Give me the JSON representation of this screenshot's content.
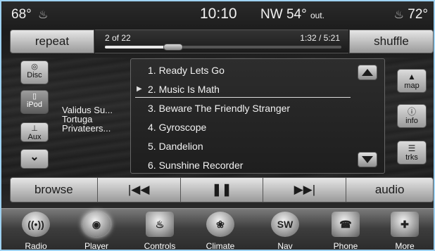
{
  "status": {
    "temp_left": "68°",
    "temp_right": "72°",
    "clock": "10:10",
    "heading": "NW",
    "outside_temp": "54°",
    "outside_label": "out."
  },
  "top": {
    "repeat_label": "repeat",
    "shuffle_label": "shuffle",
    "track_count": "2 of 22",
    "track_time": "1:32 / 5:21",
    "progress_fraction": 0.29
  },
  "sources": [
    {
      "label": "Disc",
      "icon": "disc-icon"
    },
    {
      "label": "iPod",
      "icon": "ipod-icon"
    },
    {
      "label": "Aux",
      "icon": "aux-icon"
    }
  ],
  "now_playing": {
    "line1": "Validus Su...",
    "line2": "Tortuga",
    "line3": "Privateers..."
  },
  "tracks": [
    "1. Ready Lets Go",
    "2. Music Is Math",
    "3. Beware The Friendly Stranger",
    "4. Gyroscope",
    "5. Dandelion",
    "6. Sunshine Recorder"
  ],
  "selected_track_index": 1,
  "side": {
    "map_label": "map",
    "info_label": "info",
    "trks_label": "trks"
  },
  "transport": {
    "browse_label": "browse",
    "audio_label": "audio",
    "prev_symbol": "|◀◀",
    "pause_symbol": "❚❚",
    "next_symbol": "▶▶|"
  },
  "dock": [
    {
      "label": "Radio",
      "icon": "radio-icon"
    },
    {
      "label": "Player",
      "icon": "player-icon"
    },
    {
      "label": "Controls",
      "icon": "controls-icon"
    },
    {
      "label": "Climate",
      "icon": "climate-icon"
    },
    {
      "label": "Nav",
      "icon": "nav-icon",
      "glyph": "SW"
    },
    {
      "label": "Phone",
      "icon": "phone-icon"
    },
    {
      "label": "More",
      "icon": "more-icon"
    }
  ],
  "colors": {
    "frame": "#9fd2f2",
    "button_top": "#e6e6e6",
    "button_bottom": "#9a9a9a"
  }
}
